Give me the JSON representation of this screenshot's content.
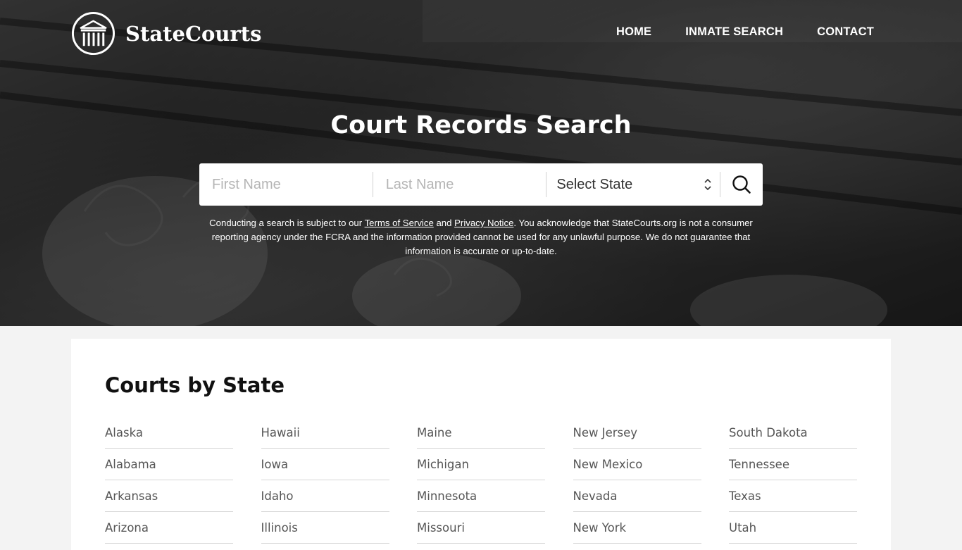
{
  "brand": {
    "name": "StateCourts"
  },
  "nav": {
    "items": [
      "HOME",
      "INMATE SEARCH",
      "CONTACT"
    ]
  },
  "hero": {
    "title": "Court Records Search"
  },
  "search": {
    "first_name_placeholder": "First Name",
    "last_name_placeholder": "Last Name",
    "state_selected": "Select State"
  },
  "disclaimer": {
    "p1": "Conducting a search is subject to our ",
    "terms": "Terms of Service",
    "p2": " and ",
    "privacy": "Privacy Notice",
    "p3": ". You acknowledge that StateCourts.org is not a consumer reporting agency under the FCRA and the information provided cannot be used for any unlawful purpose. We do not guarantee that information is accurate or up-to-date."
  },
  "courts": {
    "title": "Courts by State",
    "states": [
      "Alaska",
      "Hawaii",
      "Maine",
      "New Jersey",
      "South Dakota",
      "Alabama",
      "Iowa",
      "Michigan",
      "New Mexico",
      "Tennessee",
      "Arkansas",
      "Idaho",
      "Minnesota",
      "Nevada",
      "Texas",
      "Arizona",
      "Illinois",
      "Missouri",
      "New York",
      "Utah"
    ]
  }
}
